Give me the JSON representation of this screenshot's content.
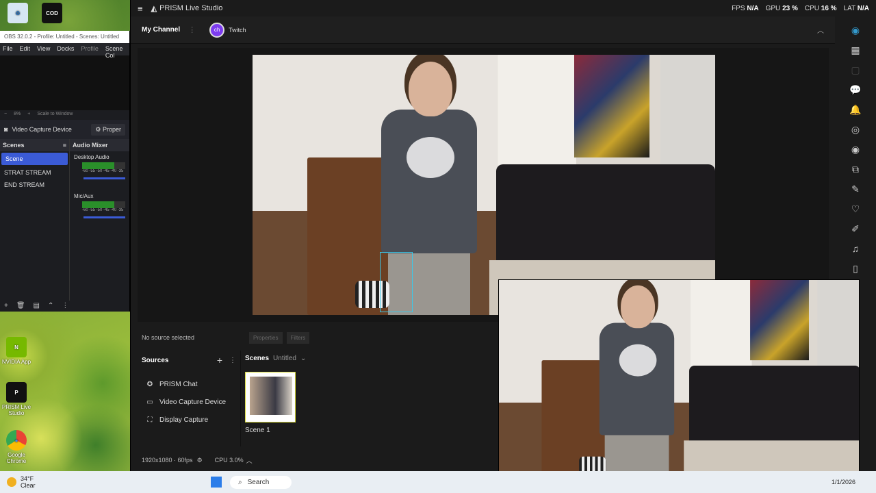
{
  "desktop": {
    "icons": [
      {
        "label": "",
        "glyph": "♻"
      },
      {
        "label": "",
        "glyph": "COD"
      },
      {
        "label": "NVIDIA App",
        "glyph": "N"
      },
      {
        "label": "PRISM Live Studio",
        "glyph": "P"
      },
      {
        "label": "Google Chrome",
        "glyph": "●"
      }
    ]
  },
  "obs": {
    "title": "OBS 32.0.2 - Profile: Untitled - Scenes: Untitled",
    "menu": [
      "File",
      "Edit",
      "View",
      "Docks",
      "Profile",
      "Scene Col"
    ],
    "zoom": {
      "minus": "−",
      "value": "8%",
      "plus": "+",
      "mode": "Scale to Window"
    },
    "source_name": "Video Capture Device",
    "properties_label": "Proper",
    "scenes_header": "Scenes",
    "mixer_header": "Audio Mixer",
    "scenes": [
      "Scene",
      "STRAT STREAM",
      "END STREAM"
    ],
    "mixer": [
      {
        "name": "Desktop Audio",
        "ticks": "-60 -55 -50 -45 -40 -35"
      },
      {
        "name": "Mic/Aux",
        "ticks": "-60 -55 -50 -45 -40 -35"
      }
    ]
  },
  "prism": {
    "app_title": "PRISM Live Studio",
    "stats": {
      "fps_label": "FPS",
      "fps": "N/A",
      "gpu_label": "GPU",
      "gpu": "23 %",
      "cpu_label": "CPU",
      "cpu": "16 %",
      "lat_label": "LAT",
      "lat": "N/A"
    },
    "channel_title": "My Channel",
    "platform": "Twitch",
    "no_source": "No source selected",
    "properties_btn": "Properties",
    "filters_btn": "Filters",
    "sources_header": "Sources",
    "sources": [
      {
        "label": "PRISM Chat",
        "icon": "chat-icon"
      },
      {
        "label": "Video Capture Device",
        "icon": "camera-icon"
      },
      {
        "label": "Display Capture",
        "icon": "display-icon"
      }
    ],
    "scenes_header": "Scenes",
    "scenes_collection": "Untitled",
    "scene_card": "Scene 1",
    "resolution": "1920x1080 · 60fps",
    "cpu_status": "CPU 3.0%"
  },
  "taskbar": {
    "temp": "34°F",
    "condition": "Clear",
    "search": "Search",
    "date": "1/1/2026"
  },
  "colors": {
    "accent": "#3b5bd6",
    "selection": "#3cc8e8",
    "scene_border": "#d7d93a",
    "twitch": "#7d3cf0"
  }
}
